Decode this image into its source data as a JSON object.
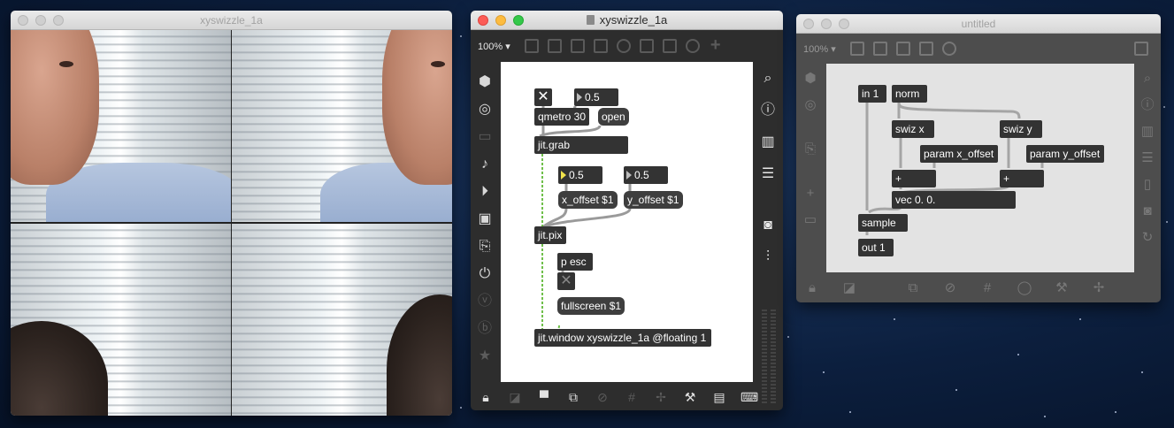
{
  "desktop": {
    "background": "#0c1f3e"
  },
  "video_window": {
    "title": "xyswizzle_1a"
  },
  "patcher_window": {
    "title": "xyswizzle_1a",
    "zoom": "100%",
    "objects": {
      "toggle_top": "✕",
      "num_top": "0.5",
      "qmetro": "qmetro 30",
      "open": "open",
      "jitgrab": "jit.grab",
      "num_x": "0.5",
      "num_y": "0.5",
      "xoffset": "x_offset $1",
      "yoffset": "y_offset $1",
      "jitpix": "jit.pix",
      "pesc": "p esc",
      "toggle_mid": "✕",
      "fullscreen": "fullscreen $1",
      "jitwindow": "jit.window xyswizzle_1a @floating 1"
    }
  },
  "untitled_window": {
    "title": "untitled",
    "zoom": "100%",
    "objects": {
      "in1": "in 1",
      "norm": "norm",
      "swizx": "swiz x",
      "swizy": "swiz y",
      "param_x": "param x_offset",
      "param_y": "param y_offset",
      "plus_x": "+",
      "plus_y": "+",
      "vec": "vec 0. 0.",
      "sample": "sample",
      "out1": "out 1"
    }
  }
}
